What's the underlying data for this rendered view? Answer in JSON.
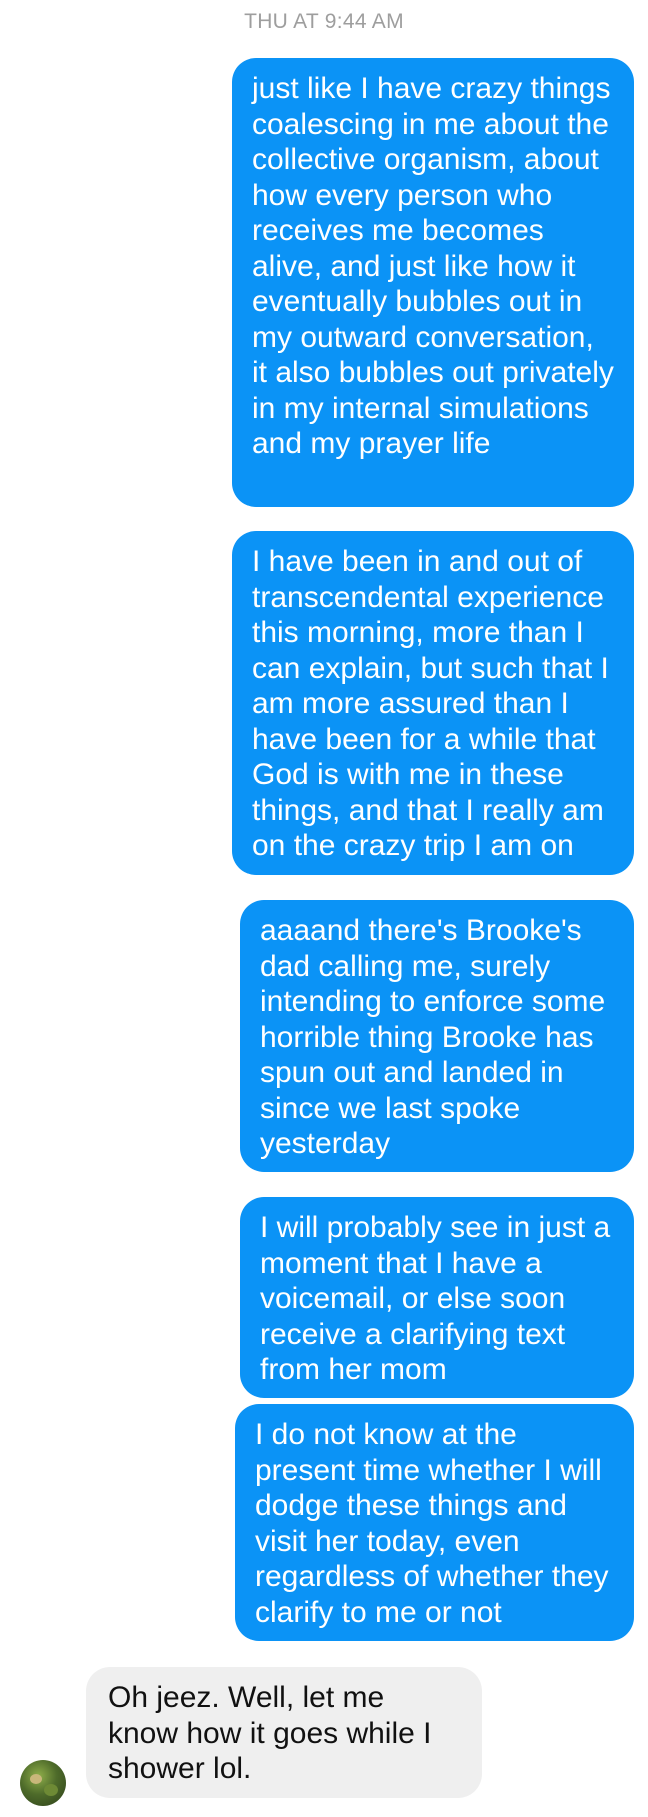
{
  "header": {
    "timestamp": "THU AT 9:44 AM"
  },
  "messages": [
    {
      "direction": "outgoing",
      "text": "just like I have crazy things coalescing in me about the collective organism, about how every person who receives me becomes alive, and just like how it eventually bubbles out in my outward conversation, it also bubbles out privately in my internal simulations and my prayer life"
    },
    {
      "direction": "outgoing",
      "text": "I have been in and out of transcendental experience this morning, more than I can explain, but such that I am more assured than I have been for a while that God is with me in these things, and that I really am on the crazy trip I am on"
    },
    {
      "direction": "outgoing",
      "text": "aaaand there's Brooke's dad calling me, surely intending to enforce some horrible thing Brooke has spun out and landed in since we last spoke yesterday"
    },
    {
      "direction": "outgoing",
      "text": "I will probably see in just a moment that I have a voicemail, or else soon receive a clarifying text from her mom"
    },
    {
      "direction": "outgoing",
      "text": "I do not know at the present time whether I will dodge these things and visit her today, even regardless of whether they clarify to me or not"
    },
    {
      "direction": "incoming",
      "text": "Oh jeez. Well, let me know how it goes while I shower lol."
    }
  ],
  "colors": {
    "outgoing_bubble": "#0b93f6",
    "incoming_bubble": "#efefef",
    "timestamp_text": "#9e9e9e"
  },
  "icons": {
    "sender_avatar": "avatar-photo"
  }
}
